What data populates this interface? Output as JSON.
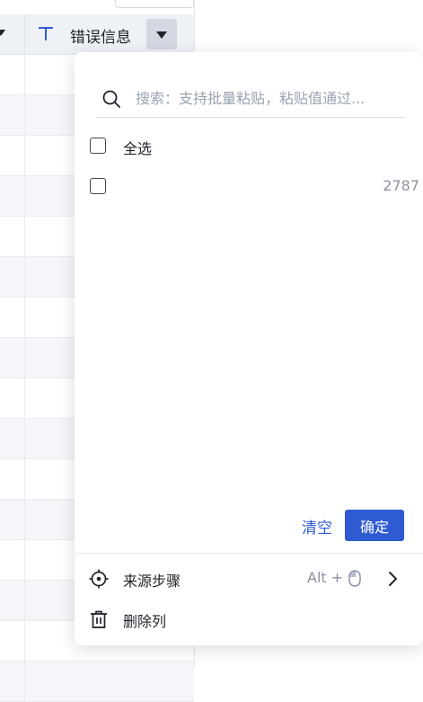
{
  "column_header": {
    "title": "错误信息",
    "type_icon": "text-type-icon",
    "dropdown_icon": "caret-down-icon"
  },
  "filter_popup": {
    "search": {
      "placeholder": "搜索：支持批量粘贴，粘贴值通过...",
      "value": "",
      "icon": "search-icon"
    },
    "select_all": {
      "label": "全选",
      "checked": false
    },
    "options": [
      {
        "label": "",
        "count": "2787",
        "checked": false
      }
    ],
    "clear_label": "清空",
    "confirm_label": "确定"
  },
  "context_menu": {
    "source_step": {
      "label": "来源步骤",
      "shortcut": "Alt +",
      "icons": [
        "crosshair-icon",
        "mouse-icon",
        "chevron-right-icon"
      ]
    },
    "delete_column": {
      "label": "删除列",
      "icon": "trash-icon"
    }
  },
  "colors": {
    "accent": "#2e5bd1",
    "header_bg": "#eef1f6",
    "row_alt_bg": "#f4f6fa"
  }
}
